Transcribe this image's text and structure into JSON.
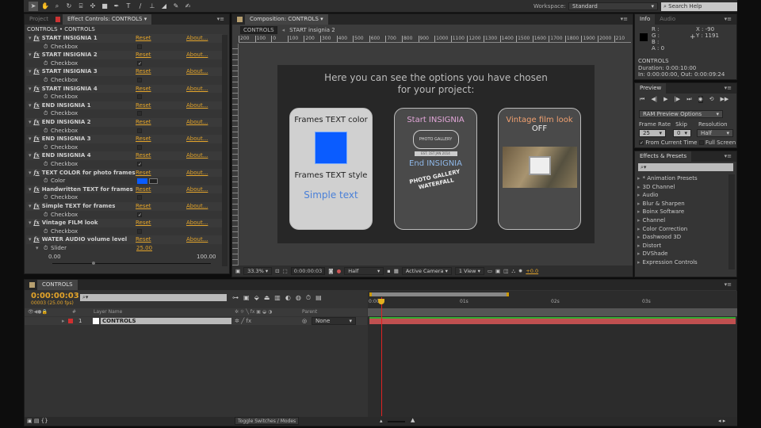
{
  "toolbar": {
    "tools": [
      "selection-tool",
      "hand-tool",
      "zoom-tool",
      "rotate-tool",
      "camera-tool",
      "pan-behind-tool",
      "rectangle-tool",
      "pen-tool",
      "type-tool",
      "brush-tool",
      "clone-stamp-tool",
      "eraser-tool",
      "roto-brush-tool",
      "puppet-pin-tool"
    ],
    "workspace_label": "Workspace:",
    "workspace_value": "Standard",
    "search_placeholder": "Search Help"
  },
  "effect_controls": {
    "tab_project": "Project",
    "tab_title": "Effect Controls: CONTROLS",
    "breadcrumb": "CONTROLS • CONTROLS",
    "reset_label": "Reset",
    "about_label": "About...",
    "effects": [
      {
        "name": "START INSIGNIA 1",
        "param": "Checkbox",
        "type": "checkbox",
        "checked": false
      },
      {
        "name": "START INSIGNIA 2",
        "param": "Checkbox",
        "type": "checkbox",
        "checked": true
      },
      {
        "name": "START INSIGNIA 3",
        "param": "Checkbox",
        "type": "checkbox",
        "checked": false
      },
      {
        "name": "START INSIGNIA 4",
        "param": "Checkbox",
        "type": "checkbox",
        "checked": false
      },
      {
        "name": "END INSIGNIA 1",
        "param": "Checkbox",
        "type": "checkbox",
        "checked": false
      },
      {
        "name": "END INSIGNIA 2",
        "param": "Checkbox",
        "type": "checkbox",
        "checked": false
      },
      {
        "name": "END INSIGNIA 3",
        "param": "Checkbox",
        "type": "checkbox",
        "checked": false
      },
      {
        "name": "END INSIGNIA 4",
        "param": "Checkbox",
        "type": "checkbox",
        "checked": true
      },
      {
        "name": "TEXT COLOR for photo frames",
        "param": "Color",
        "type": "color",
        "color": "#0a5cff"
      },
      {
        "name": "Handwritten TEXT for frames",
        "param": "Checkbox",
        "type": "checkbox",
        "checked": false
      },
      {
        "name": "Simple TEXT for frames",
        "param": "Checkbox",
        "type": "checkbox",
        "checked": true
      },
      {
        "name": "Vintage FILM look",
        "param": "Checkbox",
        "type": "checkbox",
        "checked": false
      },
      {
        "name": "WATER AUDIO volume level",
        "param": "Slider",
        "type": "slider",
        "value": "25.00"
      }
    ],
    "slider_min": "0.00",
    "slider_max": "100.00",
    "slider_fraction": 0.25
  },
  "composition": {
    "tab_title": "Composition: CONTROLS",
    "crumbs": [
      "CONTROLS",
      "START insignia 2"
    ],
    "ruler": [
      "200",
      "100",
      "0",
      "100",
      "200",
      "300",
      "400",
      "500",
      "600",
      "700",
      "800",
      "900",
      "1000",
      "1100",
      "1200",
      "1300",
      "1400",
      "1500",
      "1600",
      "1700",
      "1800",
      "1900",
      "2000",
      "210"
    ],
    "heading": [
      "Here you can see the options you have chosen",
      "for your project:"
    ],
    "card1": {
      "title": "Frames TEXT color",
      "swatch": "#0a5cff",
      "subtitle": "Frames TEXT style",
      "sample": "Simple text"
    },
    "card2": {
      "title": "Start INSIGNIA",
      "title_color": "#e2a6d8",
      "insignia1": "PHOTO GALLERY",
      "insignia1_ribbon": "EST. 1ST JAN 2014",
      "end_title": "End INSIGNIA",
      "end_color": "#8fb8e8",
      "insignia2a": "PHOTO GALLERY",
      "insignia2b": "WATERFALL"
    },
    "card3": {
      "title": "Vintage film look",
      "title_color": "#f0a070",
      "state": "OFF"
    },
    "footer": {
      "zoom": "33.3%",
      "timecode": "0:00:00:03",
      "resolution": "Half",
      "camera": "Active Camera",
      "views": "1 View",
      "exposure": "+0.0"
    }
  },
  "info": {
    "tab_info": "Info",
    "tab_audio": "Audio",
    "r": "R :",
    "g": "G :",
    "b": "B :",
    "a": "A : 0",
    "x": "X : -90",
    "y": "Y : 1191",
    "layer": "CONTROLS",
    "duration": "Duration: 0:00:10:00",
    "inout": "In: 0:00:00:00, Out: 0:00:09:24"
  },
  "preview": {
    "tab": "Preview",
    "ram_options": "RAM Preview Options",
    "frame_rate_label": "Frame Rate",
    "skip_label": "Skip",
    "resolution_label": "Resolution",
    "frame_rate": "25",
    "skip": "0",
    "resolution": "Half",
    "from_current": "From Current Time",
    "full_screen": "Full Screen"
  },
  "effects_presets": {
    "tab": "Effects & Presets",
    "items": [
      "* Animation Presets",
      "3D Channel",
      "Audio",
      "Blur & Sharpen",
      "Boinx Software",
      "Channel",
      "Color Correction",
      "Dashwood 3D",
      "Distort",
      "DVShade",
      "Expression Controls"
    ]
  },
  "timeline": {
    "tab": "CONTROLS",
    "timecode": "0:00:00:03",
    "frames": "00003 (25.00 fps)",
    "col_layer_name": "Layer Name",
    "col_parent": "Parent",
    "ticks": [
      "0:00s",
      "01s",
      "02s",
      "03s"
    ],
    "layers": [
      {
        "num": "1",
        "name": "CONTROLS",
        "parent": "None",
        "label_color": "#d03030"
      }
    ],
    "toggle": "Toggle Switches / Modes"
  }
}
